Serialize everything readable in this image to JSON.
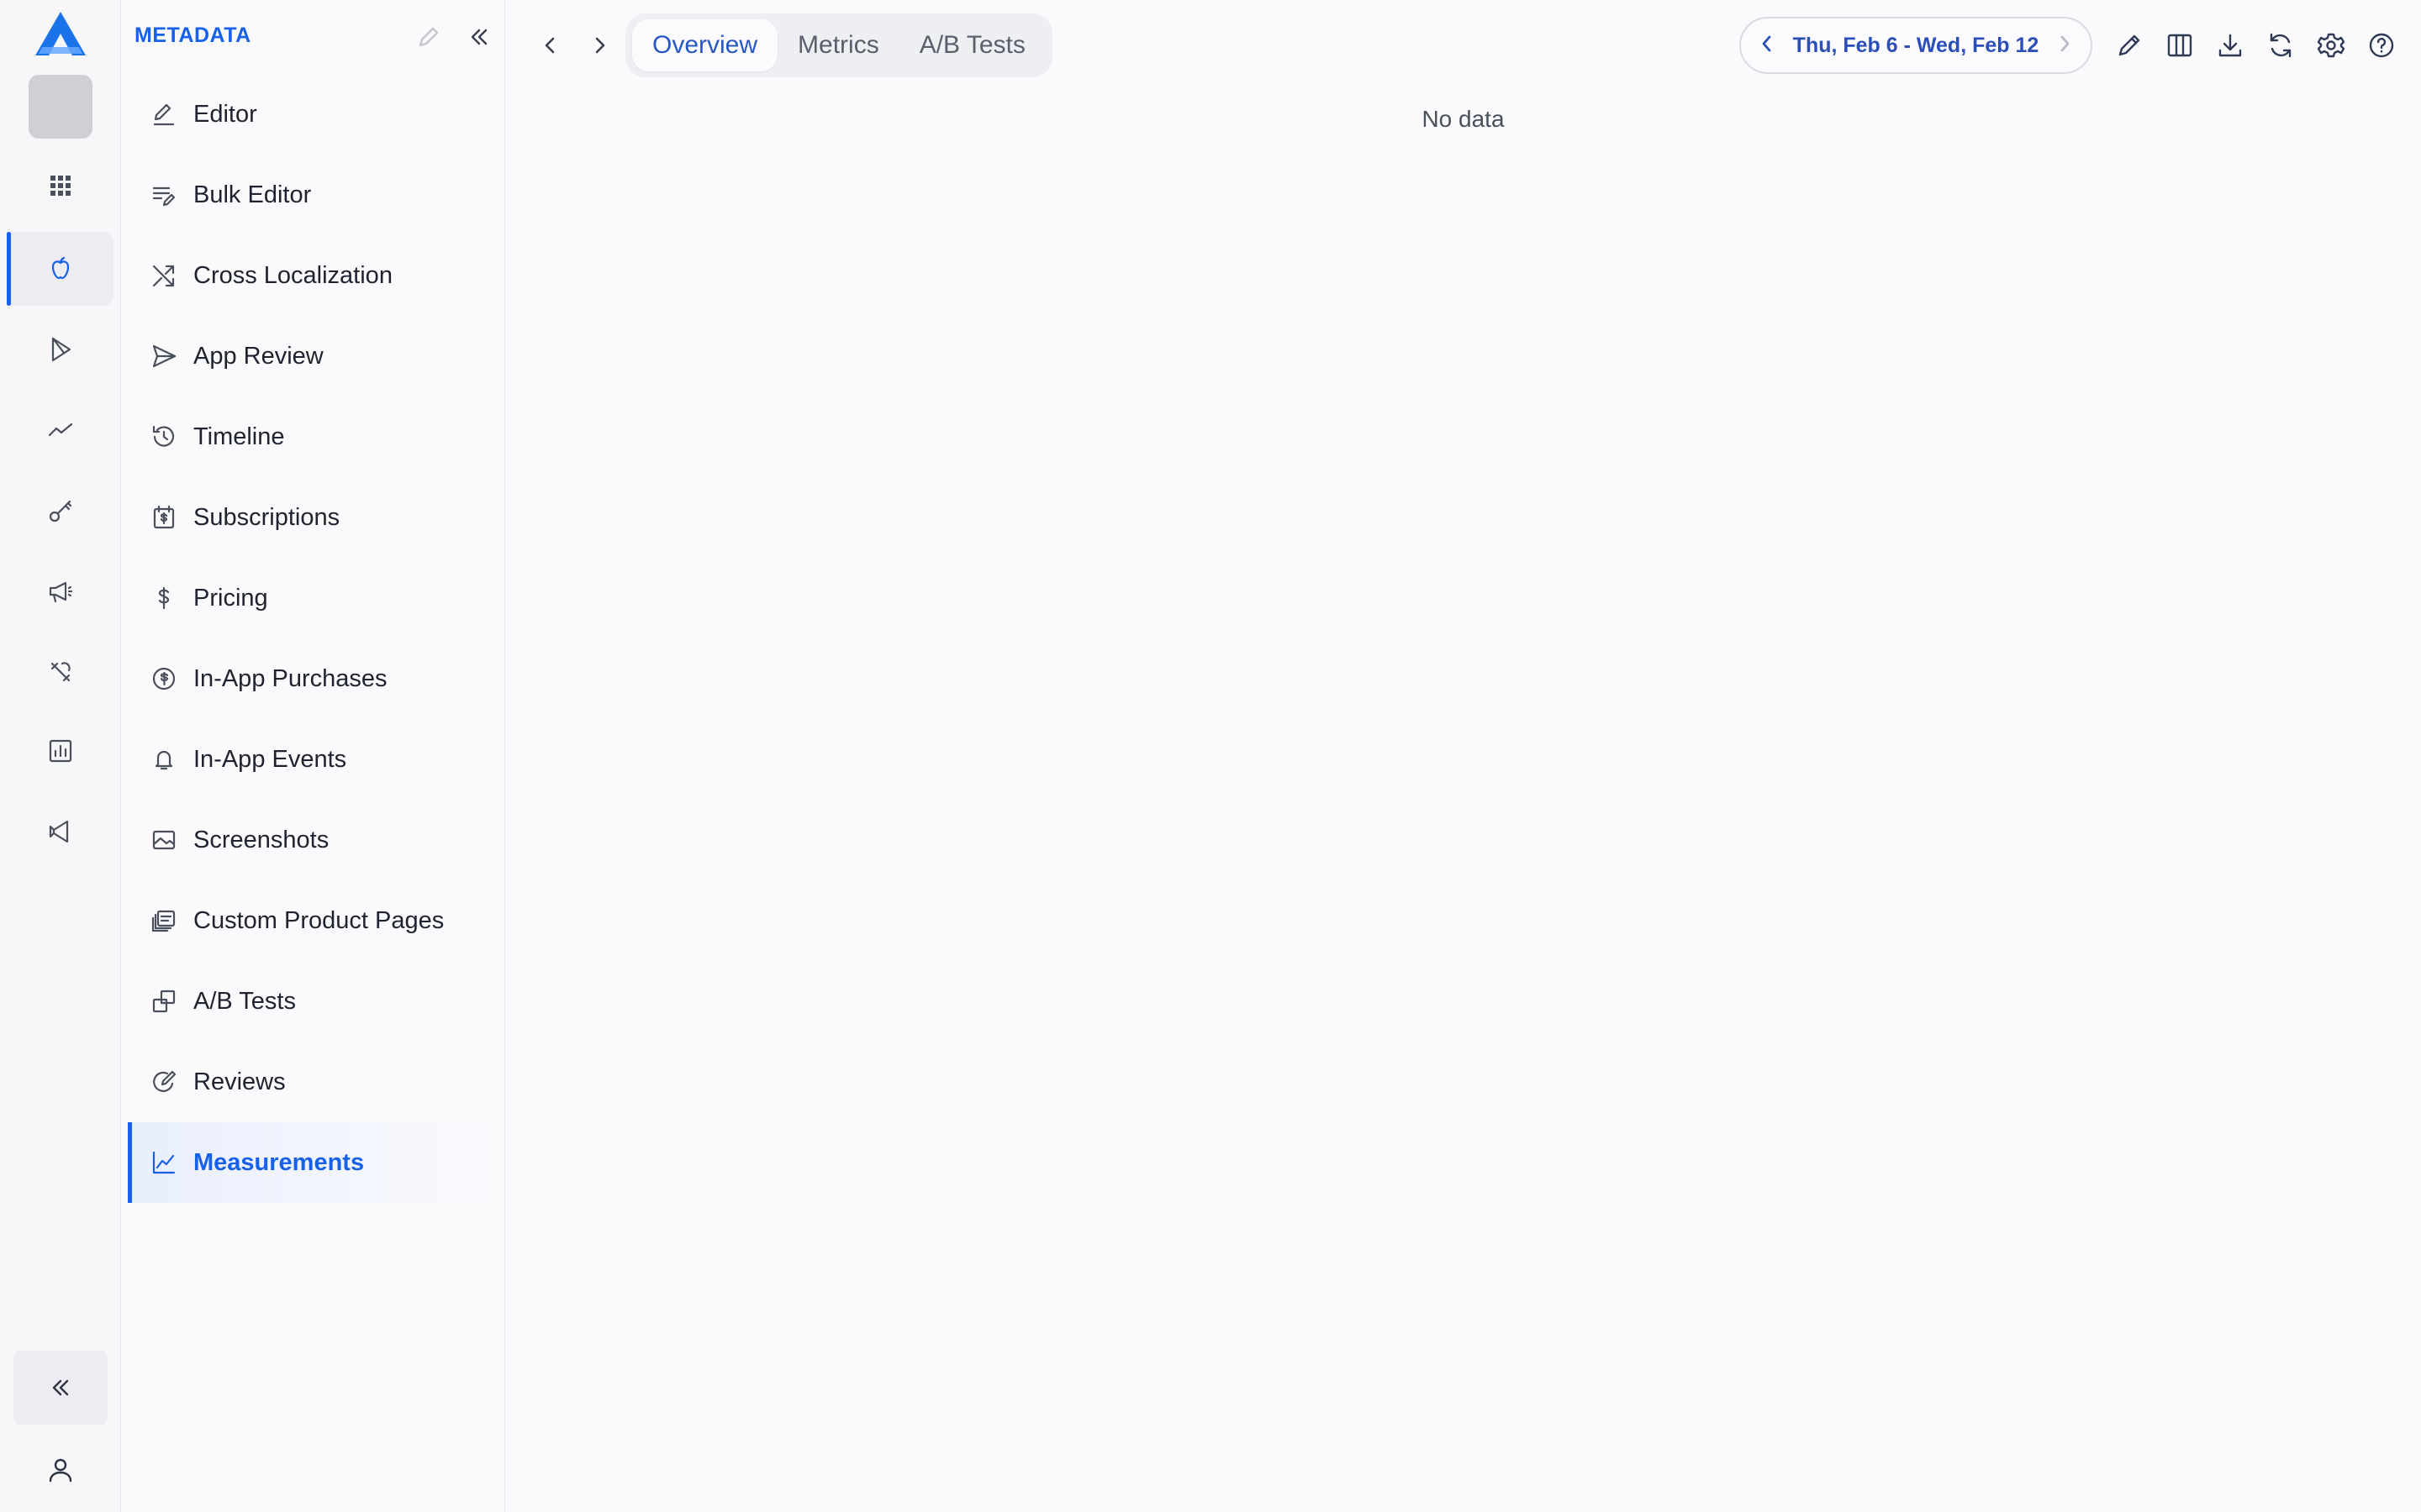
{
  "sidebar": {
    "title": "METADATA",
    "items": [
      {
        "label": "Editor",
        "icon": "pencil-line-icon"
      },
      {
        "label": "Bulk Editor",
        "icon": "list-edit-icon"
      },
      {
        "label": "Cross Localization",
        "icon": "shuffle-icon"
      },
      {
        "label": "App Review",
        "icon": "send-icon"
      },
      {
        "label": "Timeline",
        "icon": "history-icon"
      },
      {
        "label": "Subscriptions",
        "icon": "subscription-icon"
      },
      {
        "label": "Pricing",
        "icon": "dollar-icon"
      },
      {
        "label": "In-App Purchases",
        "icon": "coin-icon"
      },
      {
        "label": "In-App Events",
        "icon": "bell-icon"
      },
      {
        "label": "Screenshots",
        "icon": "image-icon"
      },
      {
        "label": "Custom Product Pages",
        "icon": "pages-icon"
      },
      {
        "label": "A/B Tests",
        "icon": "ab-test-icon"
      },
      {
        "label": "Reviews",
        "icon": "review-icon"
      },
      {
        "label": "Measurements",
        "icon": "line-chart-icon"
      }
    ],
    "active_item": "Measurements"
  },
  "tabs": [
    {
      "label": "Overview",
      "active": true
    },
    {
      "label": "Metrics",
      "active": false
    },
    {
      "label": "A/B Tests",
      "active": false
    }
  ],
  "date_range": {
    "label": "Thu, Feb 6 - Wed, Feb 12"
  },
  "main": {
    "empty_message": "No data"
  },
  "colors": {
    "accent": "#1760e8",
    "background": "#fafafd",
    "text": "#1f2330"
  }
}
